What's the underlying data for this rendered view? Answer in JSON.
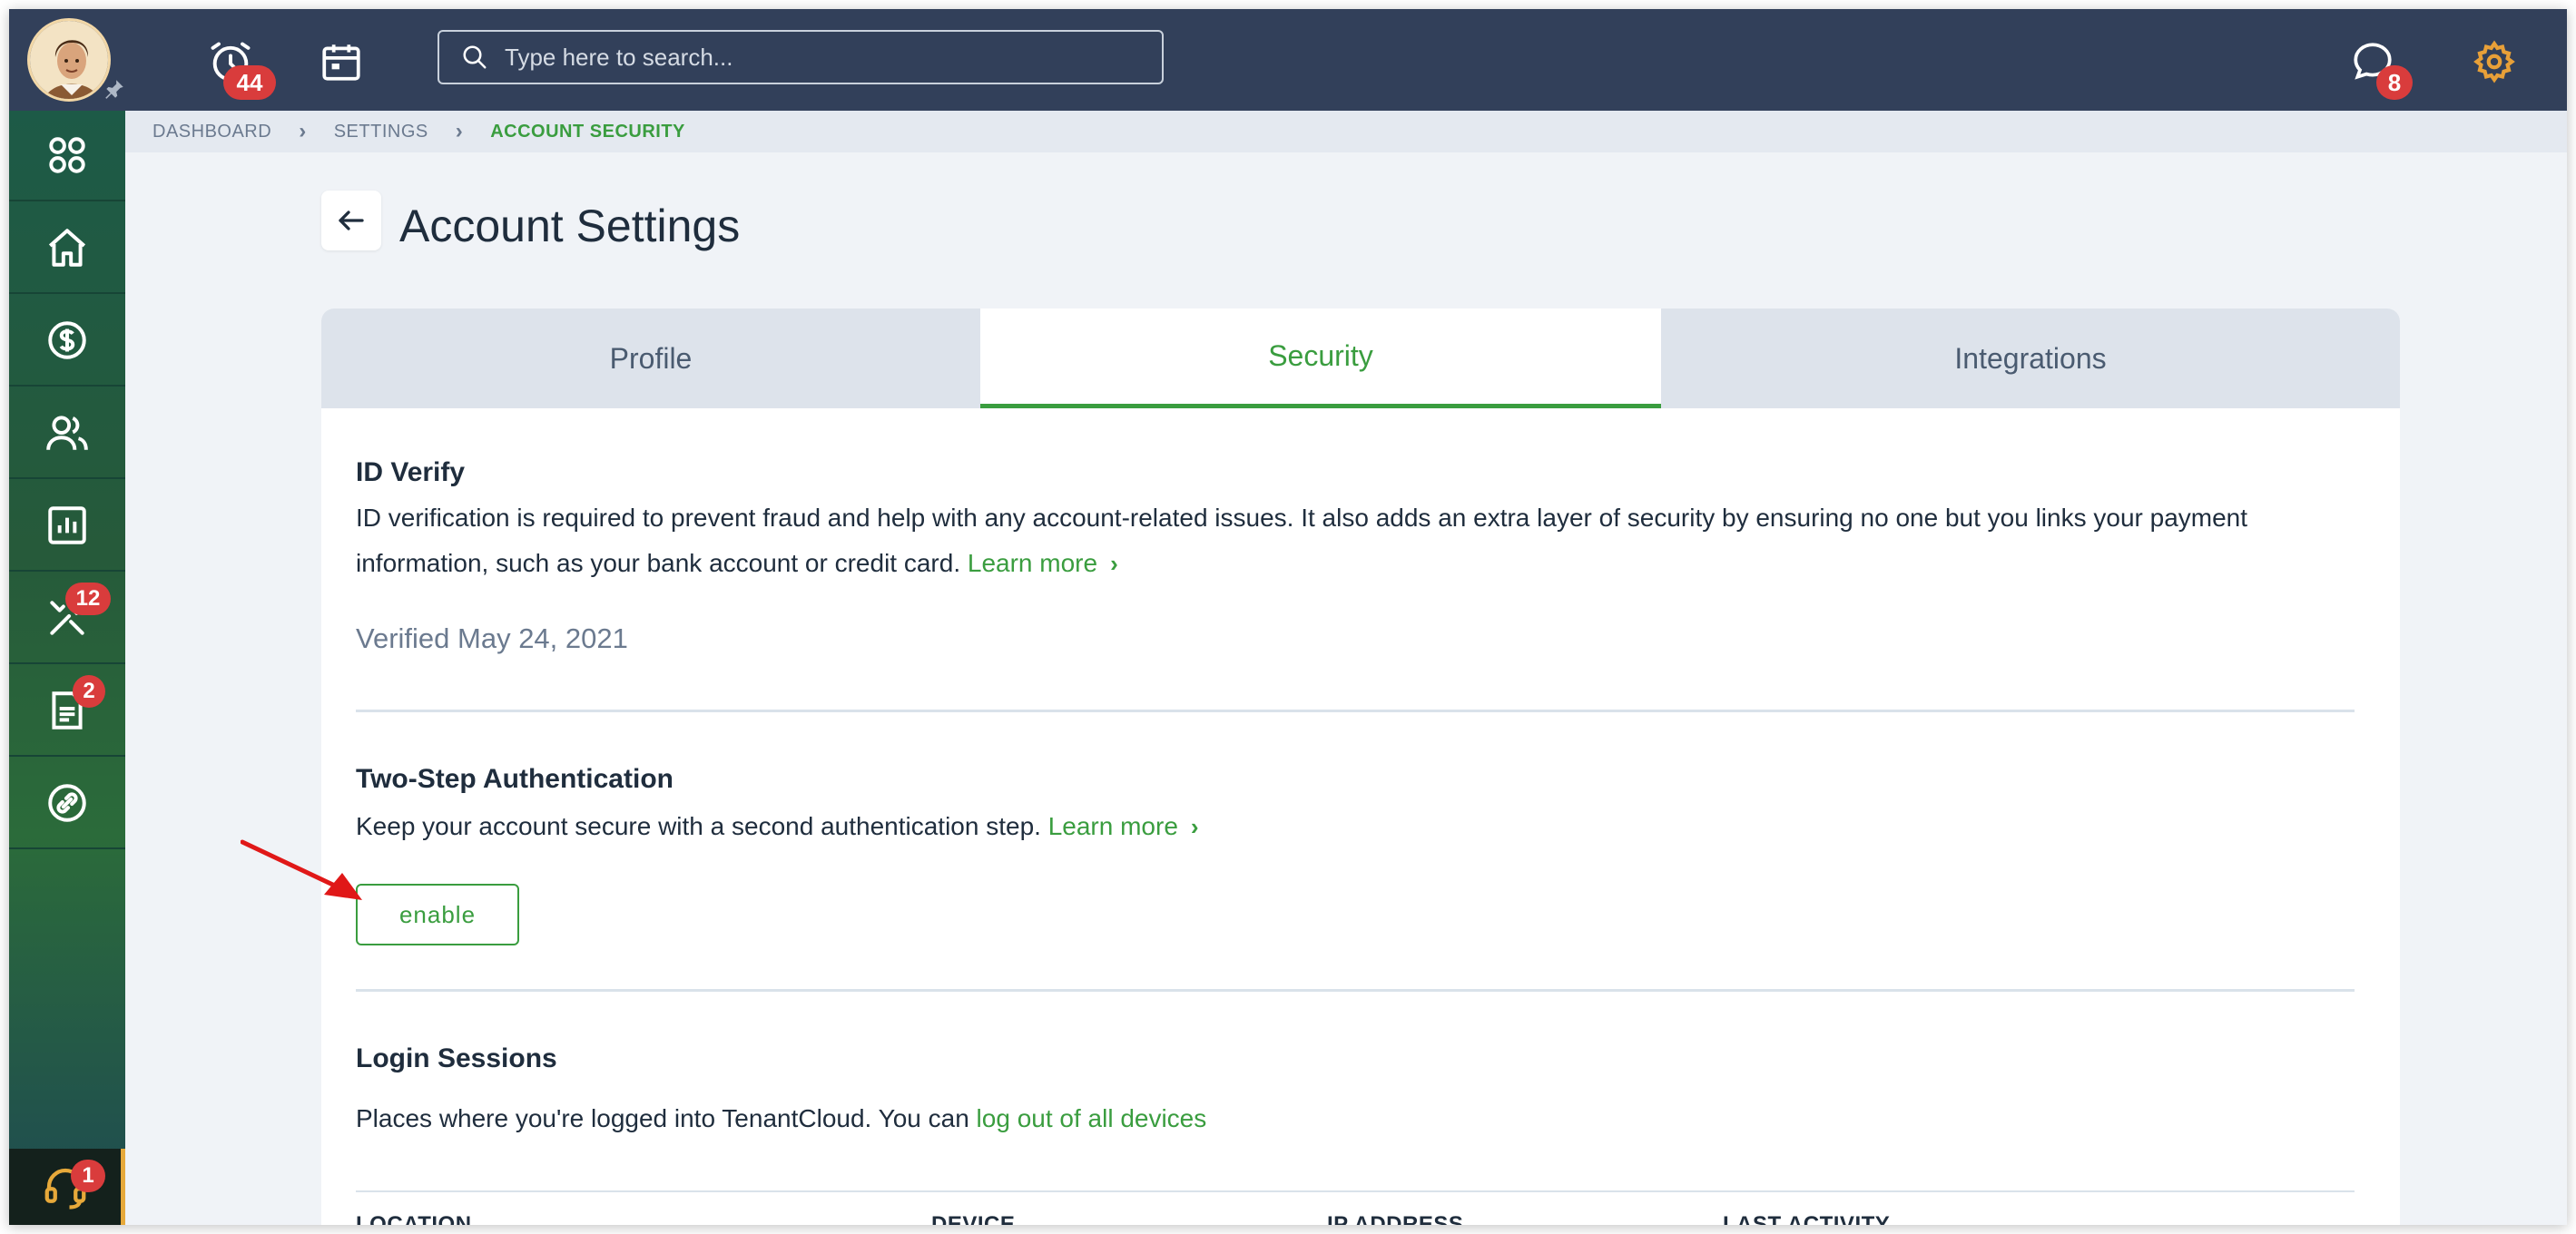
{
  "topbar": {
    "alerts_badge": "44",
    "search_placeholder": "Type here to search...",
    "messages_badge": "8"
  },
  "sidebar": {
    "tools_badge": "12",
    "documents_badge": "2",
    "support_badge": "1"
  },
  "breadcrumb": [
    "DASHBOARD",
    "SETTINGS",
    "ACCOUNT SECURITY"
  ],
  "page": {
    "title": "Account Settings",
    "tabs": [
      "Profile",
      "Security",
      "Integrations"
    ],
    "active_tab": "Security"
  },
  "id_verify": {
    "title": "ID Verify",
    "description": "ID verification is required to prevent fraud and help with any account-related issues. It also adds an extra layer of security by ensuring no one but you links your payment information, such as your bank account or credit card.",
    "learn_more": "Learn more",
    "verified": "Verified May 24, 2021"
  },
  "two_step": {
    "title": "Two-Step Authentication",
    "description": "Keep your account secure with a second authentication step.",
    "learn_more": "Learn more",
    "button": "enable"
  },
  "login_sessions": {
    "title": "Login Sessions",
    "description": "Places where you're logged into TenantCloud. You can",
    "link": "log out of all devices",
    "columns": [
      "LOCATION",
      "DEVICE",
      "IP ADDRESS",
      "LAST ACTIVITY"
    ]
  },
  "colors": {
    "accent_green": "#3a9d3f",
    "topbar": "#32405a",
    "badge_red": "#d93c3c",
    "settings_orange": "#e8a038"
  }
}
